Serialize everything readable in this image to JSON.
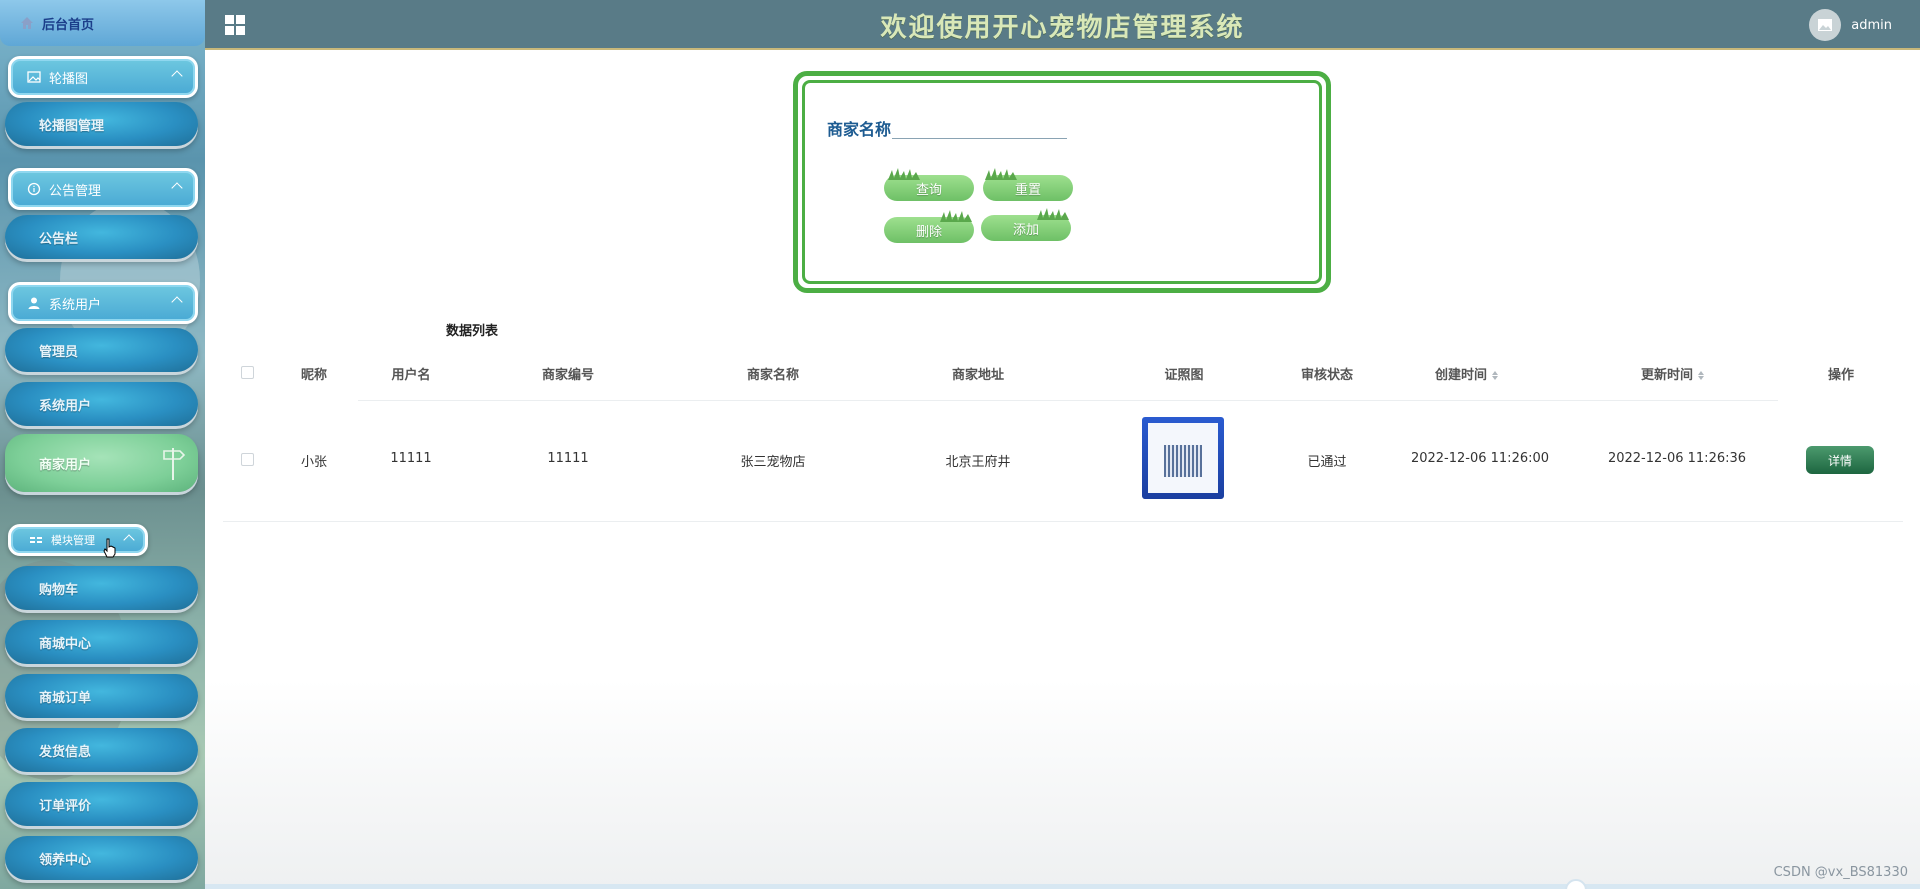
{
  "header": {
    "title": "欢迎使用开心宠物店管理系统",
    "user": "admin"
  },
  "sidebar": {
    "home": "后台首页",
    "groups": [
      {
        "label": "轮播图",
        "items": [
          "轮播图管理"
        ]
      },
      {
        "label": "公告管理",
        "items": [
          "公告栏"
        ]
      },
      {
        "label": "系统用户",
        "items": [
          "管理员",
          "系统用户",
          "商家用户"
        ]
      },
      {
        "label": "模块管理",
        "items": [
          "购物车",
          "商城中心",
          "商城订单",
          "发货信息",
          "订单评价",
          "领养中心"
        ]
      }
    ],
    "active_item": "商家用户"
  },
  "search": {
    "label": "商家名称",
    "value": "",
    "buttons": {
      "query": "查询",
      "reset": "重置",
      "delete": "删除",
      "add": "添加"
    }
  },
  "table": {
    "title": "数据列表",
    "columns": [
      "昵称",
      "用户名",
      "商家编号",
      "商家名称",
      "商家地址",
      "证照图",
      "审核状态",
      "创建时间",
      "更新时间",
      "操作"
    ],
    "rows": [
      {
        "nickname": "小张",
        "username": "11111",
        "merchant_no": "11111",
        "merchant_name": "张三宠物店",
        "address": "北京王府井",
        "license_image": "license-image",
        "status": "已通过",
        "created_at": "2022-12-06 11:26:00",
        "updated_at": "2022-12-06 11:26:36",
        "action": "详情"
      }
    ]
  },
  "watermark": "CSDN @vx_BS81330",
  "colors": {
    "header_bg": "#597b87",
    "accent_green": "#4cae44",
    "title_text": "#d9e8b8"
  }
}
